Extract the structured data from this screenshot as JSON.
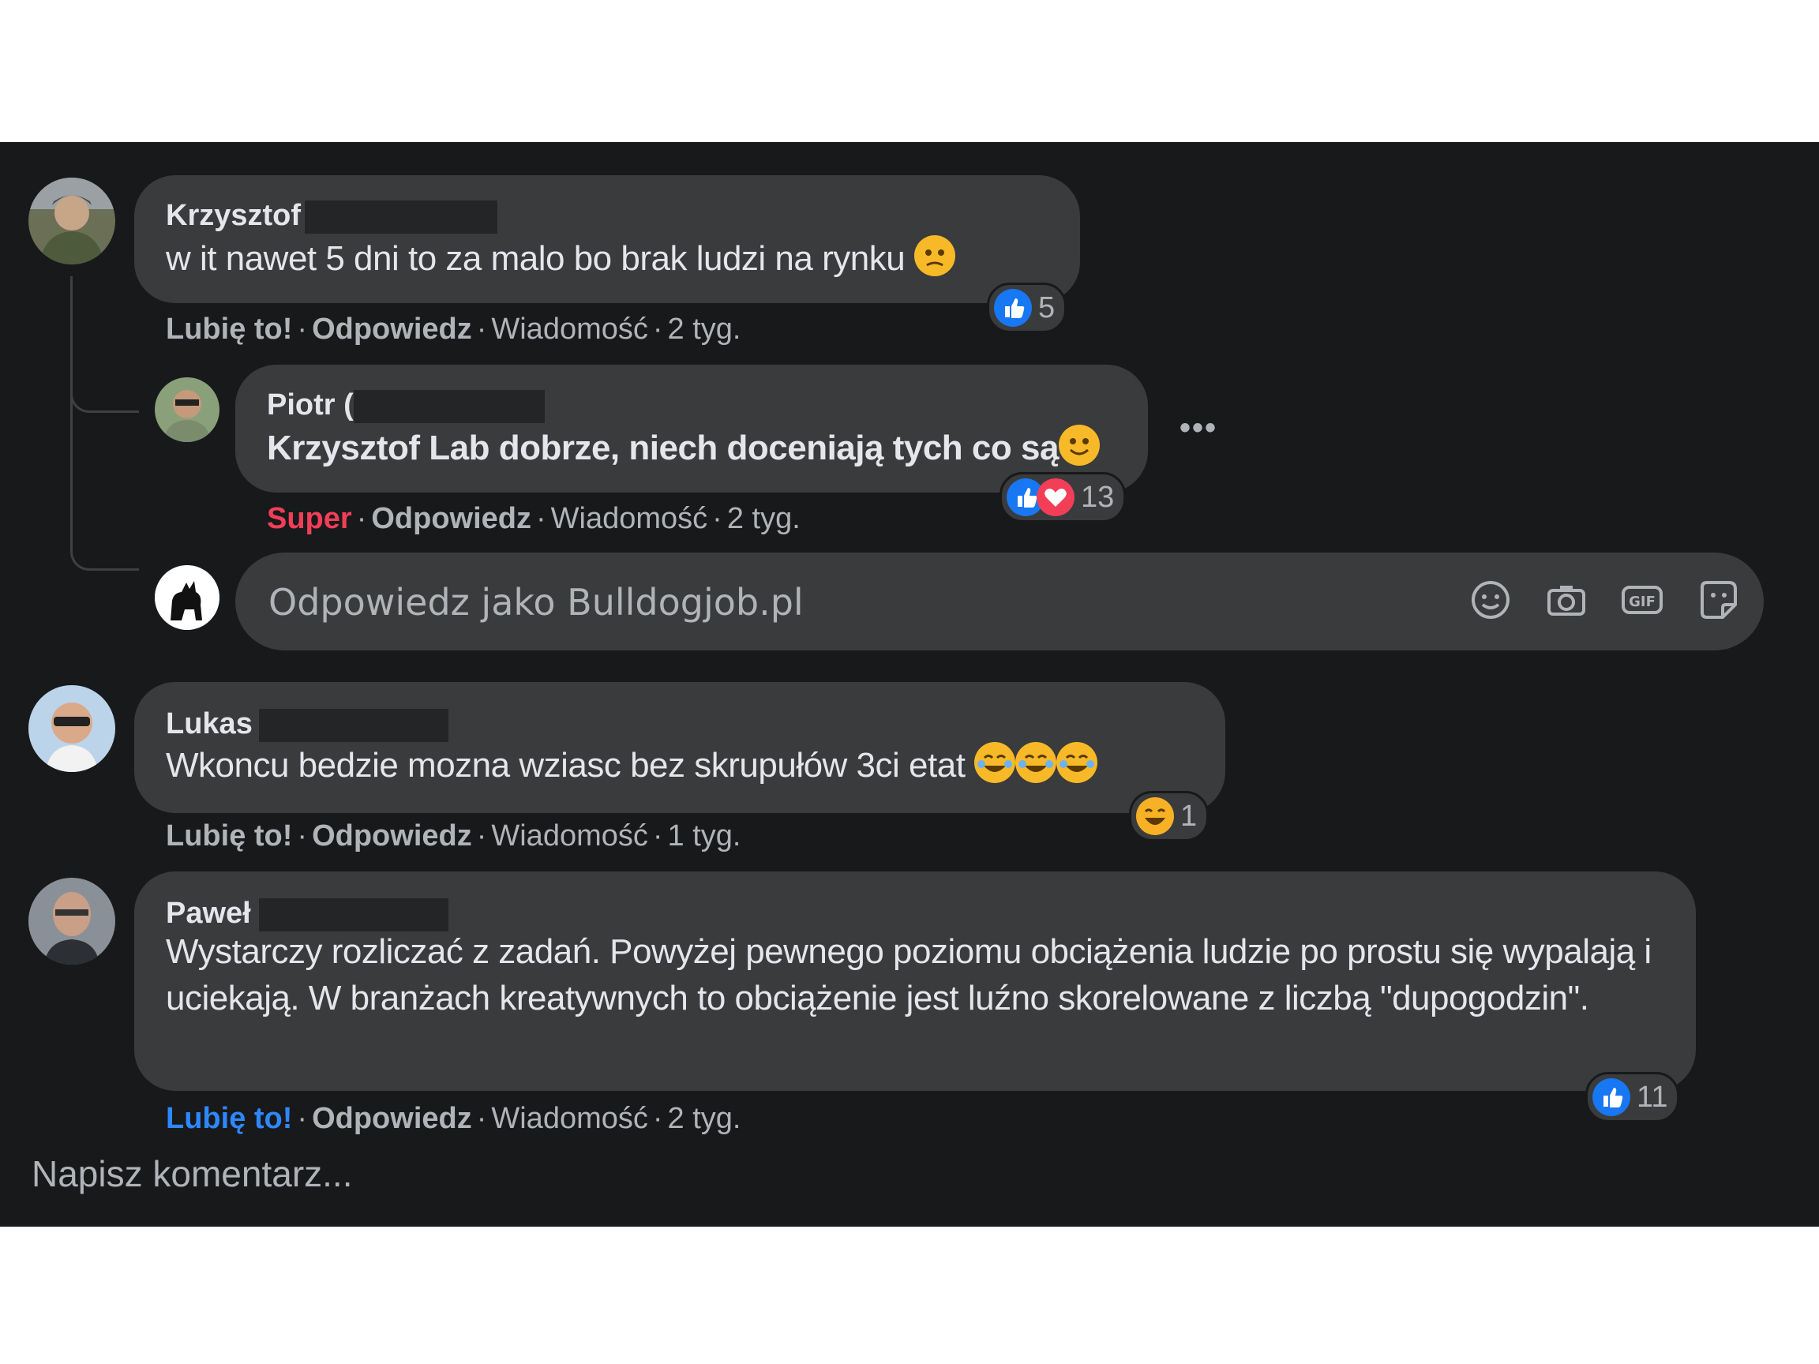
{
  "comments": [
    {
      "author": "Krzysztof",
      "text": "w it nawet 5 dni to za malo bo brak ludzi na rynku",
      "actions": {
        "like": "Lubię to!",
        "reply": "Odpowiedz",
        "message": "Wiadomość",
        "time": "2 tyg."
      },
      "reactions": {
        "icons": [
          "like"
        ],
        "count": "5"
      }
    },
    {
      "author": "Piotr (",
      "text": "Krzysztof Lab dobrze, niech doceniają tych co są",
      "actions": {
        "like": "Super",
        "reply": "Odpowiedz",
        "message": "Wiadomość",
        "time": "2 tyg."
      },
      "reactions": {
        "icons": [
          "like",
          "love"
        ],
        "count": "13"
      },
      "more": "•••"
    },
    {
      "author": "Lukas",
      "text": "Wkoncu bedzie mozna wziasc bez skrupułów 3ci etat",
      "actions": {
        "like": "Lubię to!",
        "reply": "Odpowiedz",
        "message": "Wiadomość",
        "time": "1 tyg."
      },
      "reactions": {
        "icons": [
          "haha"
        ],
        "count": "1"
      }
    },
    {
      "author": "Paweł",
      "text": "Wystarczy rozliczać z zadań. Powyżej pewnego poziomu obciążenia ludzie po prostu się wypalają i uciekają. W branżach kreatywnych to obciążenie jest luźno skorelowane z liczbą \"dupogodzin\".",
      "actions": {
        "like": "Lubię to!",
        "reply": "Odpowiedz",
        "message": "Wiadomość",
        "time": "2 tyg."
      },
      "reactions": {
        "icons": [
          "like"
        ],
        "count": "11"
      }
    }
  ],
  "reply_input": {
    "placeholder": "Odpowiedz jako Bulldogjob.pl",
    "icons": [
      "smiley-icon",
      "camera-icon",
      "gif-icon",
      "sticker-icon"
    ]
  },
  "write_comment": "Napisz komentarz...",
  "colors": {
    "background": "#18191a",
    "bubble": "#3a3b3c",
    "like_blue": "#2d88ff",
    "super_red": "#f33e58"
  }
}
